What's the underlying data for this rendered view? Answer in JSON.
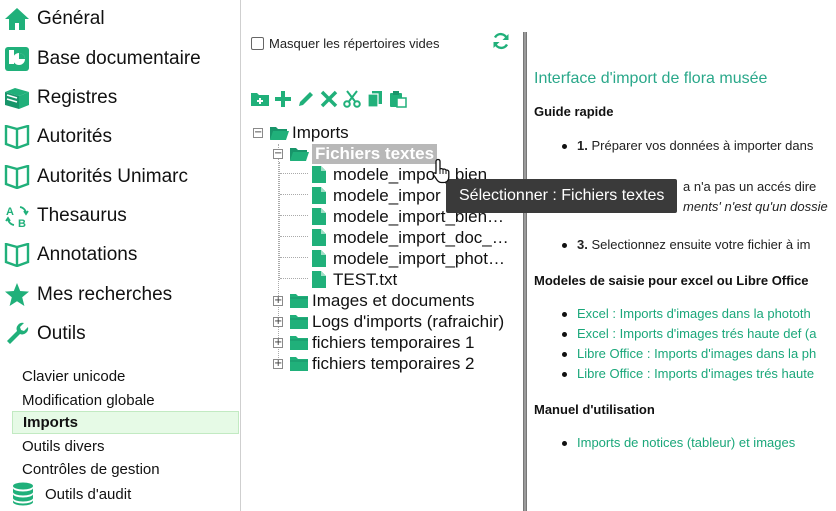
{
  "sidebar": {
    "nav": [
      {
        "label": "Général",
        "icon": "home-icon"
      },
      {
        "label": "Base documentaire",
        "icon": "document-base-icon"
      },
      {
        "label": "Registres",
        "icon": "books-icon"
      },
      {
        "label": "Autorités",
        "icon": "book-icon"
      },
      {
        "label": "Autorités Unimarc",
        "icon": "book-icon"
      },
      {
        "label": "Thesaurus",
        "icon": "thesaurus-icon"
      },
      {
        "label": "Annotations",
        "icon": "book-icon"
      },
      {
        "label": "Mes recherches",
        "icon": "star-icon"
      },
      {
        "label": "Outils",
        "icon": "wrench-icon"
      }
    ],
    "sub": [
      {
        "label": "Clavier unicode"
      },
      {
        "label": "Modification globale"
      },
      {
        "label": "Imports",
        "active": true
      },
      {
        "label": "Outils divers"
      },
      {
        "label": "Contrôles de gestion"
      }
    ],
    "audit_label": "Outils d'audit"
  },
  "tree_panel": {
    "hide_empty_label": "Masquer les répertoires vides",
    "toolbar": [
      "new-folder-icon",
      "add-icon",
      "edit-icon",
      "delete-icon",
      "cut-icon",
      "copy-icon",
      "paste-icon"
    ],
    "root": "Imports",
    "selected_folder": "Fichiers textes",
    "files": [
      "modele_import_bien",
      "modele_impor",
      "modele_import_bien…",
      "modele_import_doc_…",
      "modele_import_phot…",
      "TEST.txt"
    ],
    "folders": [
      "Images et documents",
      "Logs d'imports (rafraichir)",
      "fichiers temporaires 1",
      "fichiers temporaires 2"
    ],
    "tooltip": "Sélectionner : Fichiers textes"
  },
  "help": {
    "title": "Interface d'import de flora musée",
    "guide_heading": "Guide rapide",
    "step1_num": "1.",
    "step1_text": "Préparer vos données à importer dans",
    "step2_line1": "a n'a pas un accés dire",
    "step2_line2": "ments' n'est qu'un dossie",
    "step3_num": "3.",
    "step3_text": "Selectionnez ensuite votre fichier à im",
    "models_heading": "Modeles de saisie pour excel ou Libre Office",
    "models_links": [
      "Excel : Imports d'images dans la phototh",
      "Excel : Imports d'images trés haute def (a",
      "Libre Office : Imports d'images dans la ph",
      "Libre Office : Imports d'images trés haute"
    ],
    "manual_heading": "Manuel d'utilisation",
    "manual_links": [
      "Imports de notices (tableur) et images"
    ]
  },
  "colors": {
    "accent": "#1aa77a",
    "icon_green": "#20b07a"
  }
}
